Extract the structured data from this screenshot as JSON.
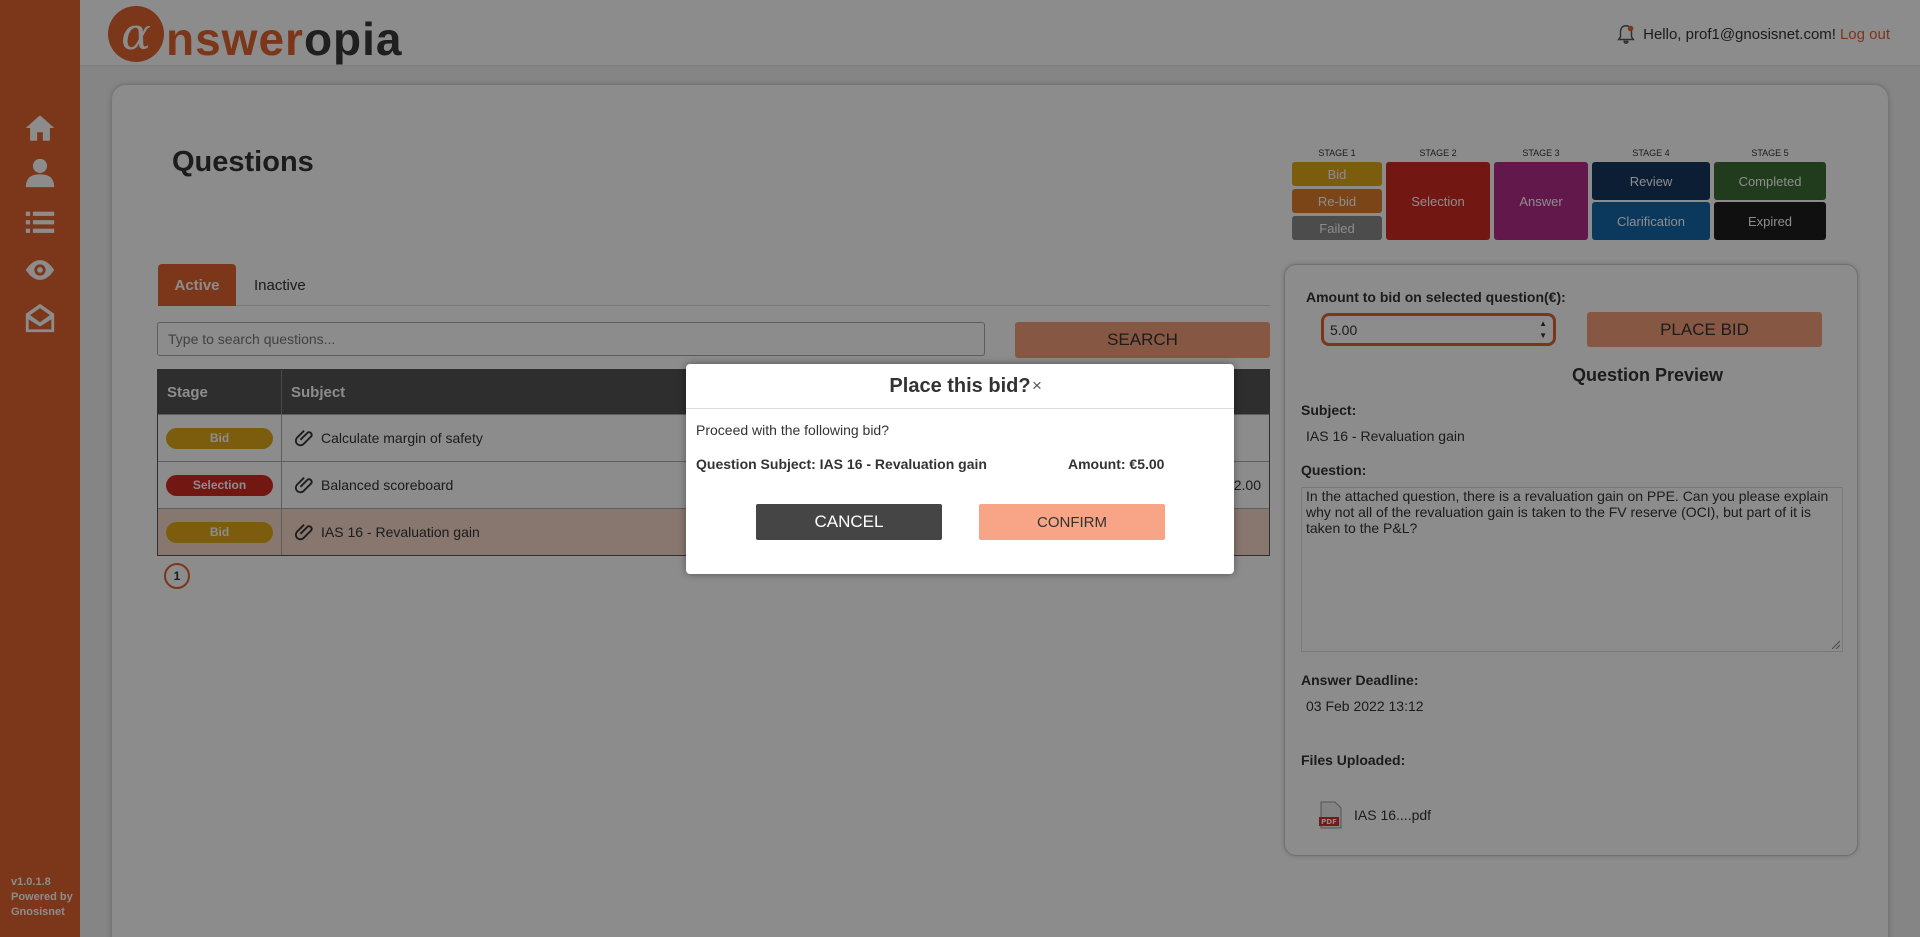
{
  "app": {
    "logo_letter": "α",
    "logo_part1": "nswer",
    "logo_part2": "opia",
    "version": "v1.0.1.8",
    "powered_by_1": "Powered by",
    "powered_by_2": "Gnosisnet"
  },
  "sidebar": {
    "icons": [
      "home-icon",
      "user-icon",
      "list-icon",
      "eye-icon",
      "envelope-open-icon"
    ]
  },
  "header": {
    "greeting": "Hello, prof1@gnosisnet.com!",
    "logout": "Log out"
  },
  "page": {
    "title": "Questions"
  },
  "stages": {
    "stage1": "STAGE 1",
    "stage2": "STAGE 2",
    "stage3": "STAGE 3",
    "stage4": "STAGE 4",
    "stage5": "STAGE 5",
    "bid": "Bid",
    "rebid": "Re-bid",
    "failed": "Failed",
    "selection": "Selection",
    "answer": "Answer",
    "review": "Review",
    "clarification": "Clarification",
    "completed": "Completed",
    "expired": "Expired"
  },
  "colors": {
    "brand": "#e2632e",
    "bid": "#e2a91b",
    "rebid": "#e07f2b",
    "failed": "#8a8a8a",
    "selection": "#d22b22",
    "answer": "#b52d8b",
    "review": "#16375e",
    "clarification": "#1468ac",
    "completed": "#3c6d34",
    "expired": "#1e1e1e"
  },
  "tabs": {
    "active": "Active",
    "inactive": "Inactive"
  },
  "search": {
    "placeholder": "Type to search questions...",
    "button": "SEARCH"
  },
  "table": {
    "col_stage": "Stage",
    "col_subject": "Subject",
    "rows": [
      {
        "stage": "Bid",
        "subject": "Calculate margin of safety",
        "amount": ""
      },
      {
        "stage": "Selection",
        "subject": "Balanced scoreboard",
        "amount": "2.00"
      },
      {
        "stage": "Bid",
        "subject": "IAS 16 - Revaluation gain",
        "amount": ""
      }
    ],
    "page": "1"
  },
  "panel": {
    "amount_label": "Amount to bid on selected question(€):",
    "amount_value": "5.00",
    "place_bid": "PLACE BID",
    "preview_title": "Question Preview",
    "subject_label": "Subject:",
    "subject_value": "IAS 16 - Revaluation gain",
    "question_label": "Question:",
    "question_value": "In the attached question, there is a revaluation gain on PPE. Can you please explain why not all of the revaluation gain is taken to the FV reserve (OCI), but part of it is taken to the P&L?",
    "deadline_label": "Answer Deadline:",
    "deadline_value": "03 Feb 2022 13:12",
    "files_label": "Files Uploaded:",
    "file_name": "IAS 16....pdf"
  },
  "modal": {
    "title": "Place this bid?",
    "close": "×",
    "text": "Proceed with the following bid?",
    "subject": "Question Subject: IAS 16 - Revaluation gain",
    "amount": "Amount: €5.00",
    "cancel": "CANCEL",
    "confirm": "CONFIRM"
  }
}
